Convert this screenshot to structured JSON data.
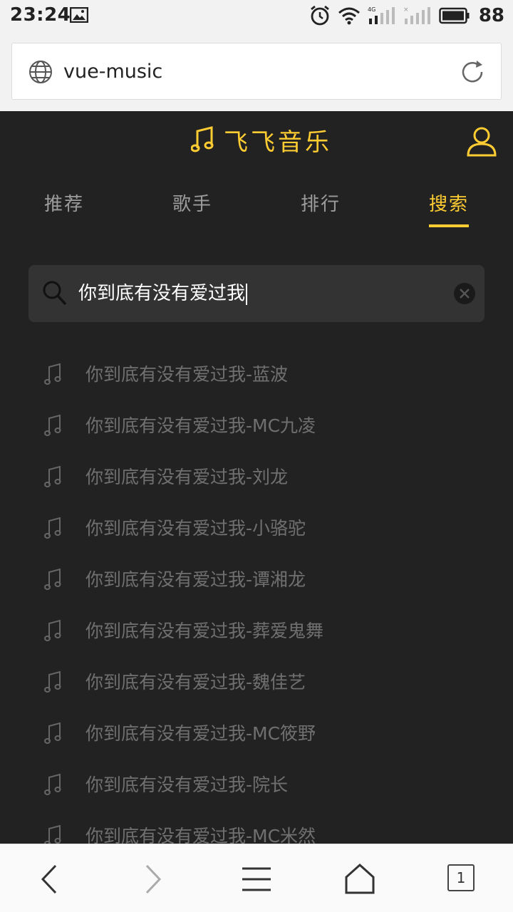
{
  "status_bar": {
    "time": "23:24",
    "battery": "88",
    "network_label": "4G"
  },
  "browser": {
    "url": "vue-music",
    "tab_count": "1"
  },
  "app": {
    "title": "飞飞音乐",
    "accent_color": "#ffcd32",
    "background_color": "#222222",
    "tabs": [
      {
        "label": "推荐",
        "active": false
      },
      {
        "label": "歌手",
        "active": false
      },
      {
        "label": "排行",
        "active": false
      },
      {
        "label": "搜索",
        "active": true
      }
    ],
    "search": {
      "query": "你到底有没有爱过我",
      "icon": "search-icon",
      "clear_icon": "clear-icon"
    },
    "suggestions": [
      "你到底有没有爱过我-蓝波",
      "你到底有没有爱过我-MC九凌",
      "你到底有没有爱过我-刘龙",
      "你到底有没有爱过我-小骆驼",
      "你到底有没有爱过我-谭湘龙",
      "你到底有没有爱过我-葬爱鬼舞",
      "你到底有没有爱过我-魏佳艺",
      "你到底有没有爱过我-MC筱野",
      "你到底有没有爱过我-院长",
      "你到底有没有爱过我-MC米然"
    ]
  }
}
